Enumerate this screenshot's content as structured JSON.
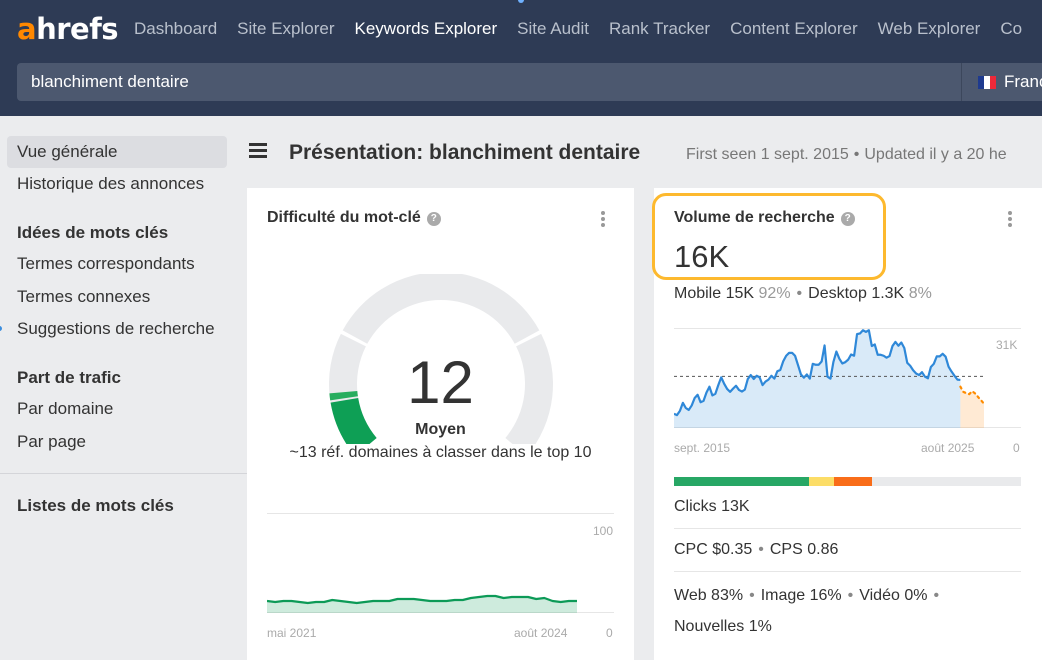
{
  "brand": {
    "logo_accent": "a",
    "logo_rest": "hrefs",
    "accent_color": "#ff8800"
  },
  "nav": {
    "items": [
      {
        "label": "Dashboard",
        "active": false
      },
      {
        "label": "Site Explorer",
        "active": false
      },
      {
        "label": "Keywords Explorer",
        "active": true
      },
      {
        "label": "Site Audit",
        "active": false
      },
      {
        "label": "Rank Tracker",
        "active": false
      },
      {
        "label": "Content Explorer",
        "active": false
      },
      {
        "label": "Web Explorer",
        "active": false
      },
      {
        "label": "Co",
        "active": false
      }
    ]
  },
  "search": {
    "value": "blanchiment dentaire",
    "country": "Franc",
    "country_flag": "france-flag-icon"
  },
  "sidebar": {
    "items": [
      {
        "label": "Vue générale",
        "active": true
      },
      {
        "label": "Historique des annonces"
      }
    ],
    "sections": [
      {
        "heading": "Idées de mots clés",
        "items": [
          "Termes correspondants",
          "Termes connexes",
          "Suggestions de recherche"
        ]
      },
      {
        "heading": "Part de trafic",
        "items": [
          "Par domaine",
          "Par page"
        ]
      }
    ],
    "lists_heading": "Listes de mots clés"
  },
  "header": {
    "title": "Présentation: blanchiment dentaire",
    "first_seen": "First seen 1 sept. 2015",
    "updated": "Updated il y a 20 he"
  },
  "kd_card": {
    "title": "Difficulté du mot-clé",
    "value": "12",
    "level": "Moyen",
    "description": "~13 réf. domaines à classer dans le top 10",
    "gauge_fraction": 0.12,
    "chart": {
      "x_start": "mai 2021",
      "x_end": "août 2024",
      "y_max": "100",
      "y_min": "0",
      "values": [
        12,
        11,
        12,
        12,
        11,
        10,
        11,
        11,
        13,
        12,
        11,
        10,
        11,
        12,
        12,
        12,
        14,
        14,
        14,
        13,
        12,
        12,
        12,
        13,
        13,
        15,
        16,
        17,
        17,
        15,
        16,
        16,
        16,
        14,
        15,
        12,
        11,
        12,
        12
      ],
      "color": "#0c9a57"
    }
  },
  "volume_card": {
    "title": "Volume de recherche",
    "value": "16K",
    "mobile_label": "Mobile",
    "mobile_value": "15K",
    "mobile_pct": "92%",
    "desktop_label": "Desktop",
    "desktop_value": "1.3K",
    "desktop_pct": "8%",
    "chart": {
      "x_start": "sept. 2015",
      "x_end": "août 2025",
      "y_max": "31K",
      "y_min": "0",
      "y_max_value": 31000,
      "average": 16000,
      "values": [
        4400,
        4000,
        5300,
        7800,
        6200,
        5600,
        7000,
        9300,
        10300,
        8000,
        8400,
        11000,
        12800,
        10100,
        10600,
        13300,
        15700,
        13700,
        12100,
        11200,
        12200,
        13100,
        11800,
        11300,
        11900,
        15200,
        16400,
        15200,
        16200,
        15700,
        13300,
        14400,
        15000,
        16200,
        15300,
        17600,
        18000,
        20700,
        22400,
        23300,
        23300,
        22400,
        19500,
        16600,
        15600,
        16600,
        15300,
        19900,
        19600,
        19600,
        20600,
        25600,
        15900,
        15300,
        20500,
        23700,
        21500,
        20000,
        20400,
        21200,
        22800,
        22400,
        29100,
        29300,
        30300,
        29800,
        30300,
        25400,
        25900,
        22700,
        22700,
        22400,
        21800,
        22300,
        25400,
        26700,
        25500,
        26500,
        24800,
        20200,
        19300,
        17900,
        16900,
        16400,
        17300,
        15900,
        15400,
        18900,
        19900,
        22200,
        22200,
        23000,
        22100,
        19000,
        17500,
        16200,
        15000,
        14900
      ],
      "forecast": [
        12800,
        11200,
        10800,
        10500,
        11400,
        10700,
        9600,
        8600,
        7500
      ],
      "line_color": "#2f88d8",
      "forecast_color": "#ff8c00"
    },
    "clicks_bar": [
      {
        "segment": "organic",
        "fraction": 0.39,
        "color": "#27a765"
      },
      {
        "segment": "paid",
        "fraction": 0.07,
        "color": "#fcdd67"
      },
      {
        "segment": "other",
        "fraction": 0.11,
        "color": "#f96d19"
      },
      {
        "segment": "no-click",
        "fraction": 0.43,
        "color": "#e9eaec"
      }
    ],
    "clicks": "Clicks 13K",
    "cpc": "CPC $0.35",
    "cps": "CPS 0.86",
    "serp_web": "Web 83%",
    "serp_image": "Image 16%",
    "serp_video": "Vidéo 0%",
    "serp_news": "Nouvelles 1%"
  }
}
